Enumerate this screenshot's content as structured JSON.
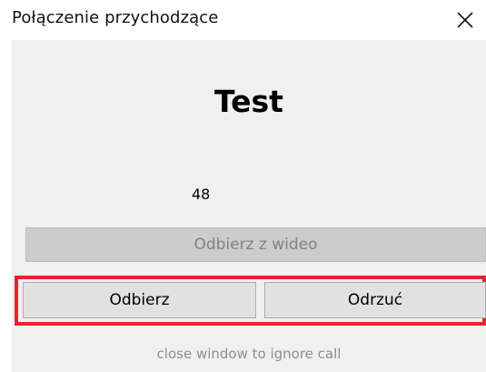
{
  "window": {
    "title": "Połączenie przychodzące",
    "close_icon": "close-icon"
  },
  "call": {
    "caller_name": "Test",
    "counter": "48"
  },
  "buttons": {
    "answer_video_label": "Odbierz z wideo",
    "answer_label": "Odbierz",
    "reject_label": "Odrzuć"
  },
  "hint": "close window to ignore call",
  "colors": {
    "content_background": "#f0f0f0",
    "button_background": "#e1e1e1",
    "disabled_button_background": "#cccccc",
    "disabled_text": "#838383",
    "highlight_border": "#e8232f",
    "hint_text": "#8e8e8e"
  }
}
